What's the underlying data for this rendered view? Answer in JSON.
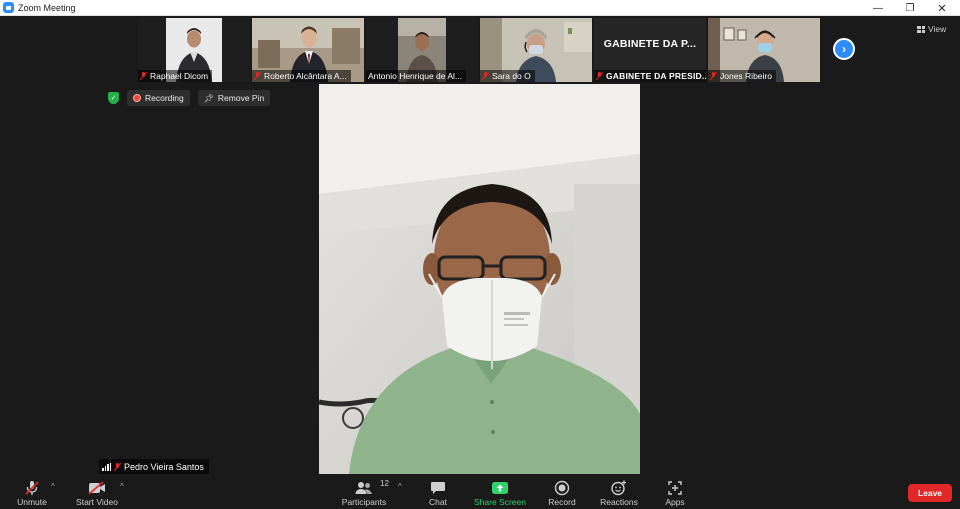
{
  "window": {
    "title": "Zoom Meeting",
    "min_glyph": "—",
    "max_glyph": "❐",
    "close_glyph": "✕"
  },
  "colors": {
    "accent": "#2d8cff",
    "leave": "#e02828",
    "share": "#2ed16a",
    "recording": "#e84b3c",
    "secure": "#23b04a"
  },
  "participants_strip": [
    {
      "name": "Raphael Dicom",
      "muted": true
    },
    {
      "name": "Roberto Alcântara A...",
      "muted": true
    },
    {
      "name": "Antonio Henrique de Al...",
      "muted": false
    },
    {
      "name": "Sara do O",
      "muted": true
    },
    {
      "name": "GABINETE DA PRESID...",
      "display": "GABINETE DA P...",
      "muted": true
    },
    {
      "name": "Jones Ribeiro",
      "muted": true
    }
  ],
  "view_button": "View",
  "status": {
    "recording": "Recording",
    "remove_pin": "Remove Pin"
  },
  "active_speaker": {
    "name": "Pedro Vieira Santos"
  },
  "toolbar": {
    "unmute": "Unmute",
    "start_video": "Start Video",
    "participants": "Participants",
    "participants_count": "12",
    "chat": "Chat",
    "share_screen": "Share Screen",
    "record": "Record",
    "reactions": "Reactions",
    "apps": "Apps",
    "leave": "Leave",
    "caret": "^"
  },
  "icons": [
    "zoom-app-icon",
    "muted-mic-icon",
    "shield-icon",
    "recording-dot-icon",
    "pin-icon",
    "chevron-right-icon",
    "grid-view-icon",
    "signal-icon",
    "video-off-icon",
    "participants-icon",
    "chat-icon",
    "share-screen-icon",
    "record-icon",
    "reactions-icon",
    "apps-icon"
  ]
}
